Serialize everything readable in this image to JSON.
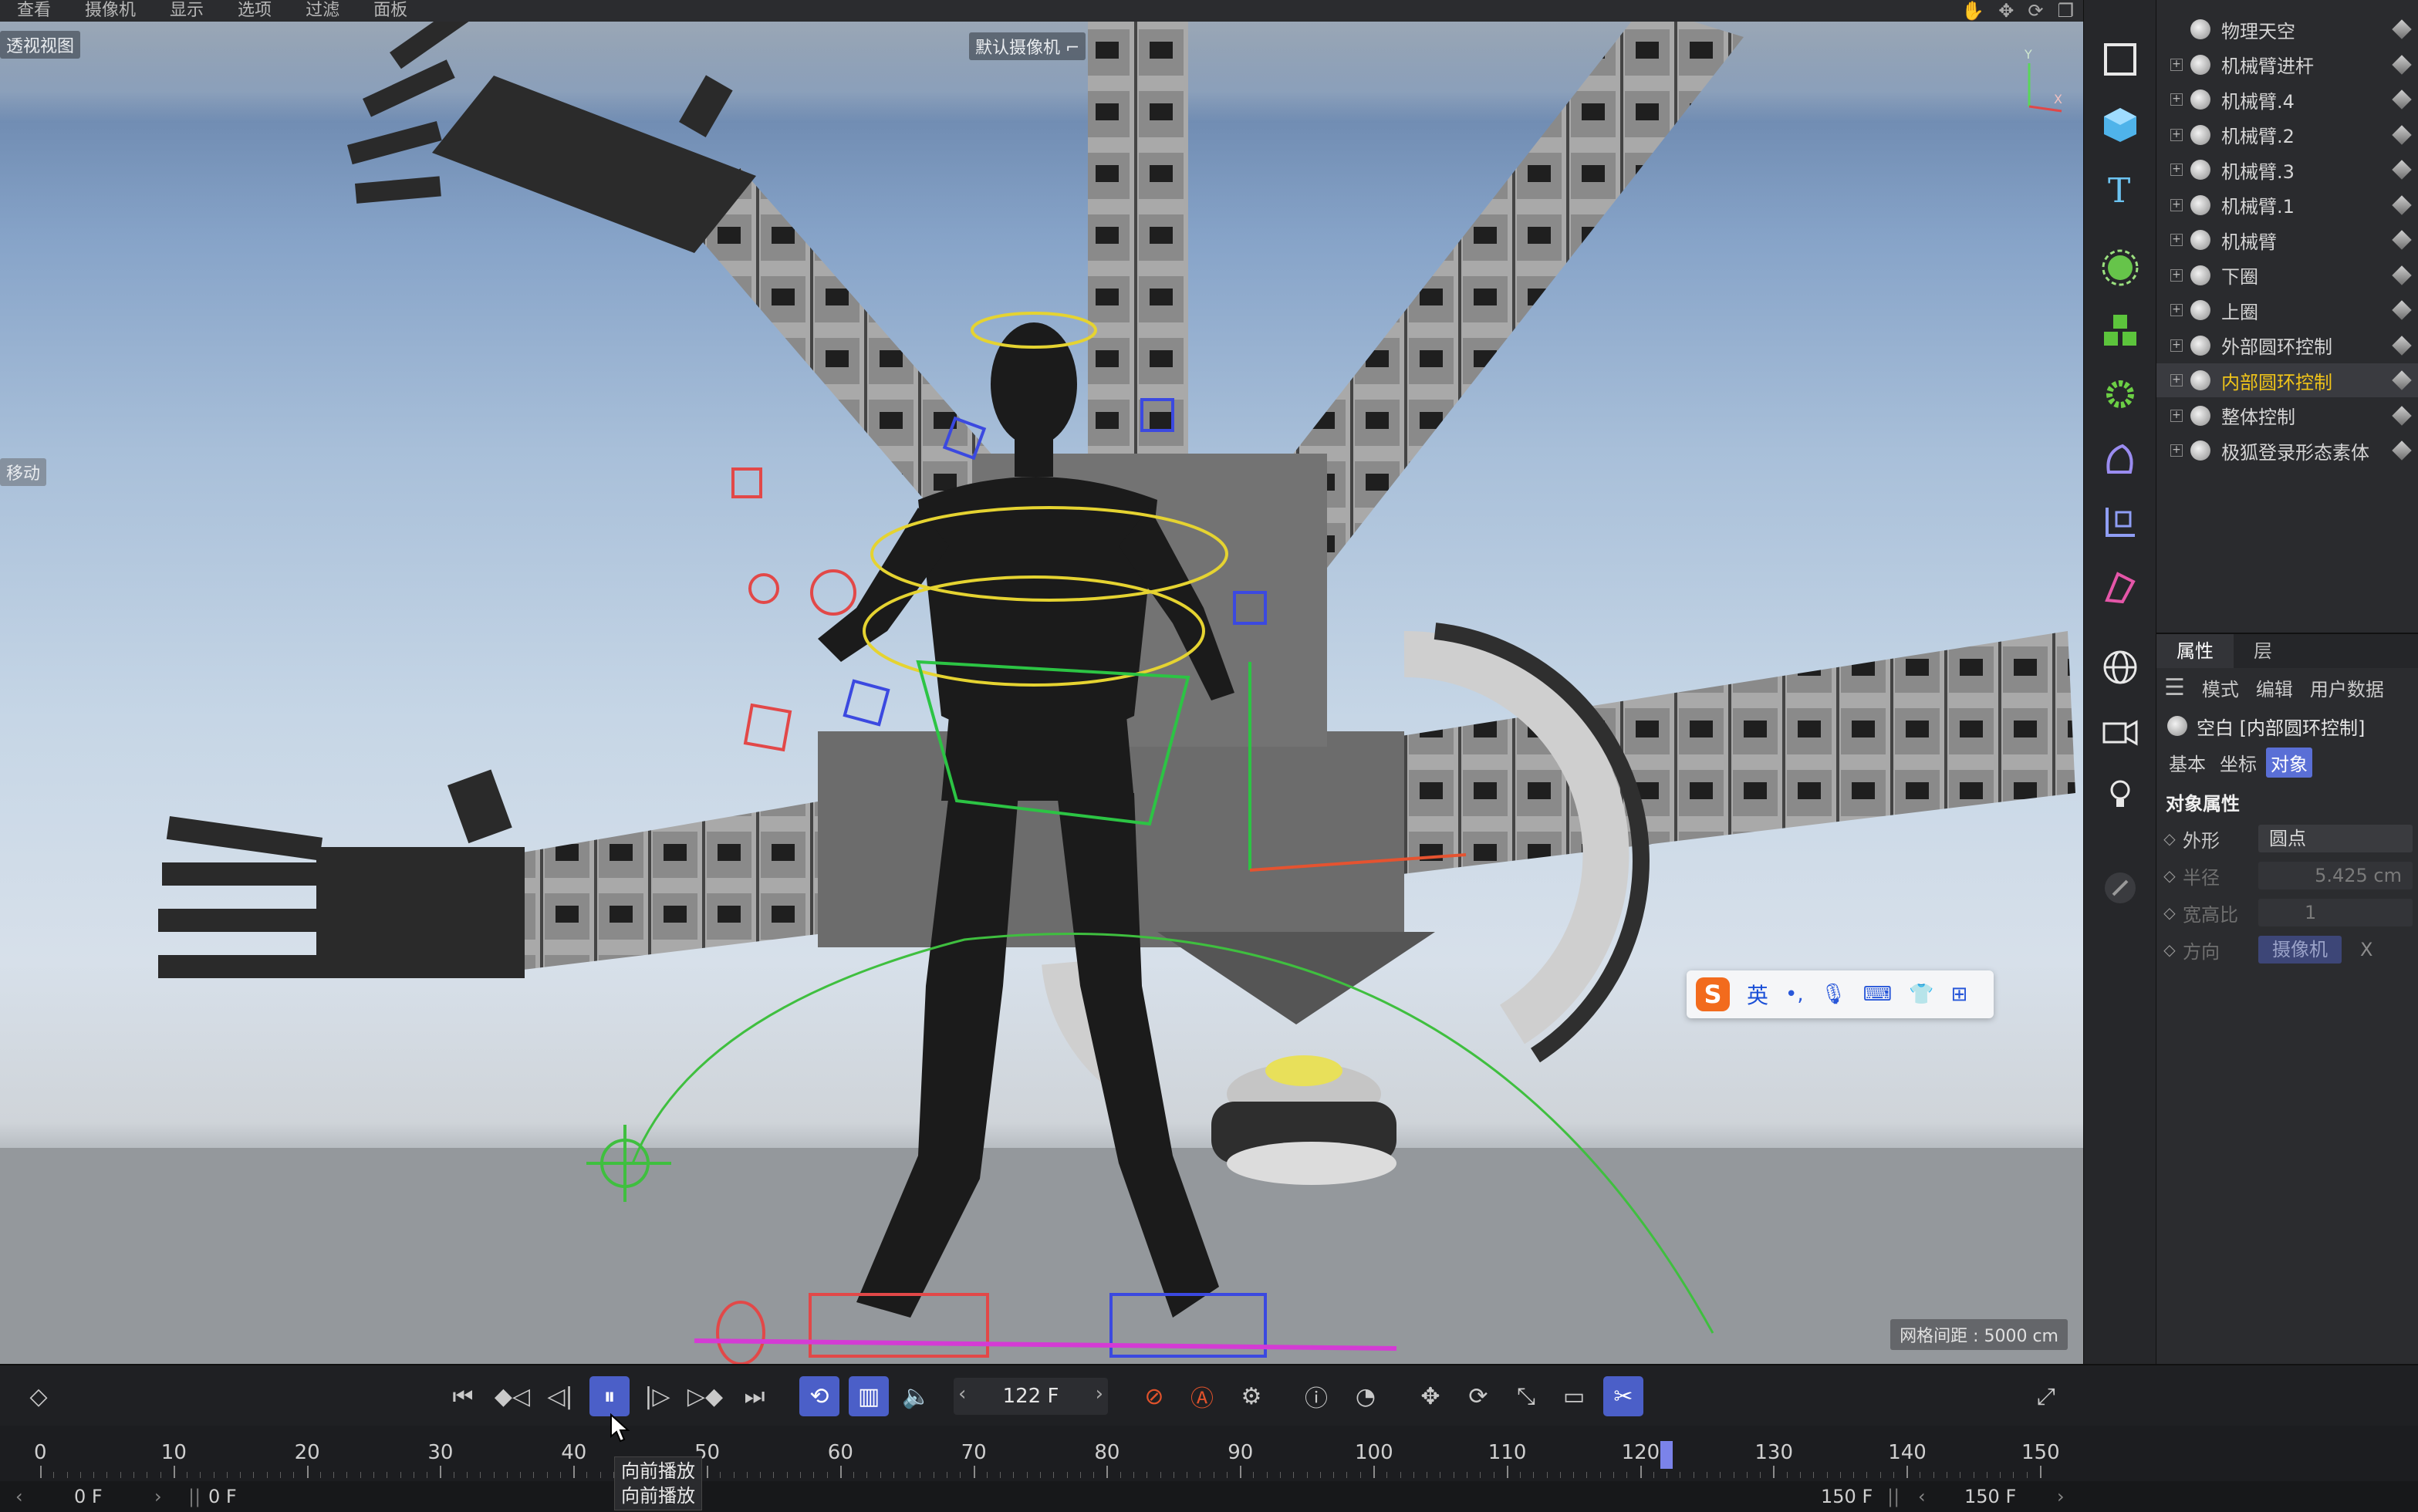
{
  "menubar": {
    "items": [
      "查看",
      "摄像机",
      "显示",
      "选项",
      "过滤",
      "面板"
    ]
  },
  "viewport": {
    "view_name": "透视视图",
    "camera_label": "默认摄像机",
    "camera_icon": "camera-link-icon",
    "side_label": "移动",
    "grid_spacing": "网格间距 : 5000 cm",
    "axis_y": "Y",
    "axis_x": "X"
  },
  "ime": {
    "logo": "S",
    "lang": "英",
    "icons": [
      "punctuation-icon",
      "microphone-icon",
      "keyboard-icon",
      "skin-icon",
      "grid-apps-icon"
    ]
  },
  "toolstrip": {
    "tools": [
      "view-frame-icon",
      "cube-icon",
      "text-icon",
      "generator-icon",
      "cloner-icon",
      "deformer-gear-icon",
      "spline-pen-icon",
      "coordinate-icon",
      "paint-tag-icon",
      "globe-icon",
      "camera-icon",
      "light-icon",
      "sketch-icon"
    ]
  },
  "objects": [
    {
      "name": "物理天空",
      "expandable": false
    },
    {
      "name": "机械臂进杆",
      "expandable": true
    },
    {
      "name": "机械臂.4",
      "expandable": true
    },
    {
      "name": "机械臂.2",
      "expandable": true
    },
    {
      "name": "机械臂.3",
      "expandable": true
    },
    {
      "name": "机械臂.1",
      "expandable": true
    },
    {
      "name": "机械臂",
      "expandable": true
    },
    {
      "name": "下圈",
      "expandable": true
    },
    {
      "name": "上圈",
      "expandable": true
    },
    {
      "name": "外部圆环控制",
      "expandable": true
    },
    {
      "name": "内部圆环控制",
      "expandable": true,
      "selected": true
    },
    {
      "name": "整体控制",
      "expandable": true
    },
    {
      "name": "极狐登录形态素体",
      "expandable": true
    }
  ],
  "attributes": {
    "tabs": [
      "属性",
      "层"
    ],
    "menu": [
      "模式",
      "编辑",
      "用户数据"
    ],
    "title": "空白 [内部圆环控制]",
    "subtabs": [
      "基本",
      "坐标",
      "对象"
    ],
    "active_subtab": "对象",
    "section": "对象属性",
    "fields": {
      "shape_label": "外形",
      "shape_value": "圆点",
      "radius_label": "半径",
      "radius_value": "5.425 cm",
      "aspect_label": "宽高比",
      "aspect_value": "1",
      "dir_label": "方向",
      "dir_value": "摄像机",
      "dir_axis": "X"
    }
  },
  "transport": {
    "current_frame": "122 F",
    "accent": "#4b5fc8",
    "record_color": "#e0522b"
  },
  "ruler": {
    "labels": [
      "0",
      "10",
      "20",
      "30",
      "40",
      "50",
      "60",
      "70",
      "80",
      "90",
      "100",
      "110",
      "120",
      "130",
      "140",
      "150"
    ],
    "playhead_frame": 122
  },
  "range": {
    "start": "0 F",
    "start2": "0 F",
    "end": "150 F",
    "end2": "150 F"
  },
  "tooltip": {
    "line1": "向前播放",
    "line2": "向前播放"
  }
}
